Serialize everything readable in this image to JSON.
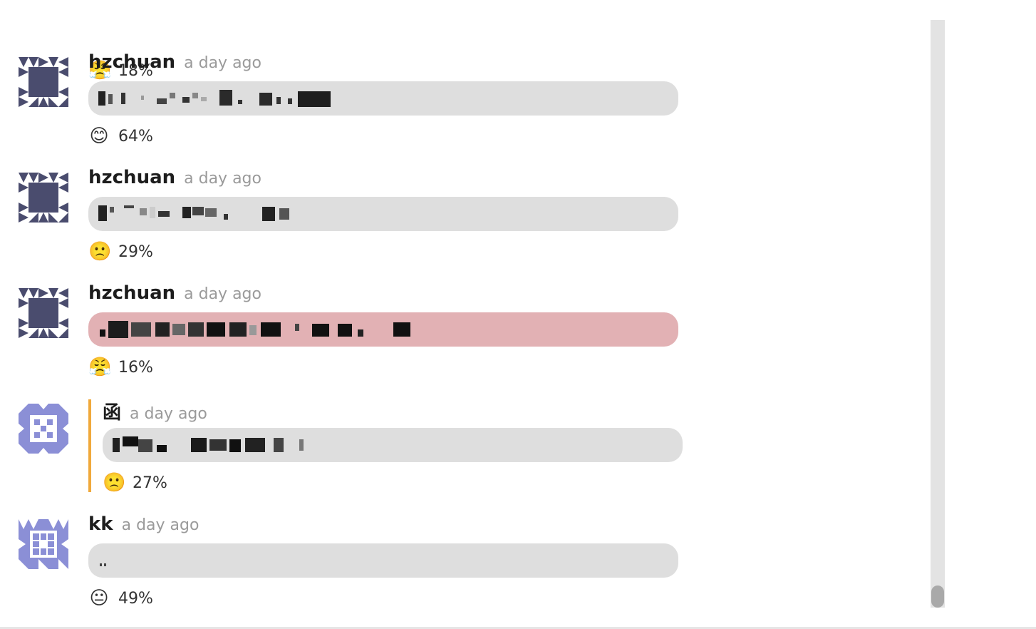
{
  "messages": [
    {
      "username": "",
      "timestamp": "",
      "sentiment": {
        "emoji": "😤",
        "percent": "18%"
      },
      "bubble_tone": "neutral"
    },
    {
      "username": "hzchuan",
      "timestamp": "a day ago",
      "sentiment": {
        "emoji": "😊",
        "percent": "64%"
      },
      "bubble_tone": "neutral"
    },
    {
      "username": "hzchuan",
      "timestamp": "a day ago",
      "sentiment": {
        "emoji": "🙁",
        "percent": "29%"
      },
      "bubble_tone": "neutral"
    },
    {
      "username": "hzchuan",
      "timestamp": "a day ago",
      "sentiment": {
        "emoji": "😤",
        "percent": "16%"
      },
      "bubble_tone": "negative"
    },
    {
      "username": "函",
      "timestamp": "a day ago",
      "sentiment": {
        "emoji": "🙁",
        "percent": "27%"
      },
      "bubble_tone": "neutral",
      "highlighted": true
    },
    {
      "username": "kk",
      "timestamp": "a day ago",
      "sentiment": {
        "emoji": "😐",
        "percent": "49%"
      },
      "bubble_tone": "neutral"
    }
  ],
  "colors": {
    "bubble_neutral": "#dedede",
    "bubble_negative": "#e2b1b4",
    "quote_bar": "#f0a93b",
    "avatar_dark": "#4a4c6e",
    "avatar_light": "#8b8fd6",
    "scroll_track": "#e3e3e3",
    "scroll_thumb": "#a9a9a9"
  }
}
